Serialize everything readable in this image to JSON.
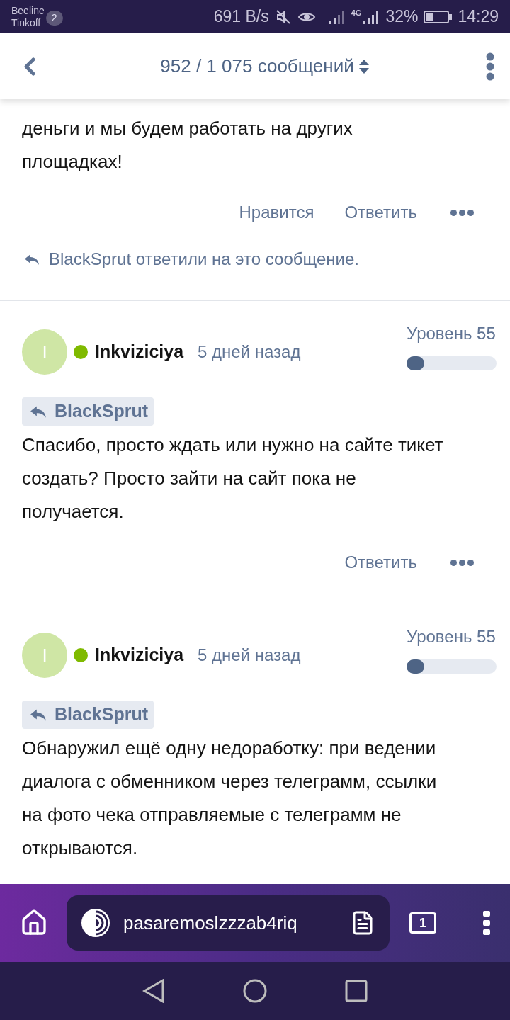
{
  "status_bar": {
    "carriers": [
      "Beeline",
      "Tinkoff"
    ],
    "sim_badge": "2",
    "speed": "691 B/s",
    "network": "4G",
    "battery": "32%",
    "time": "14:29"
  },
  "header": {
    "title": "952 / 1 075 сообщений"
  },
  "posts": [
    {
      "text": "деньги и мы будем работать на других площадках!",
      "actions": [
        "Нравится",
        "Ответить"
      ],
      "reply_note": "BlackSprut ответили на это сообщение."
    },
    {
      "author": "Inkviziciya",
      "initial": "I",
      "online": true,
      "time": "5 дней назад",
      "level_label": "Уровень 55",
      "level": 0.2,
      "quote": "BlackSprut",
      "text": "Спасибо, просто ждать или нужно на сайте тикет создать? Просто зайти на сайт пока не получается.",
      "actions": [
        "Ответить"
      ]
    },
    {
      "author": "Inkviziciya",
      "initial": "I",
      "online": true,
      "time": "5 дней назад",
      "level_label": "Уровень 55",
      "level": 0.2,
      "quote": "BlackSprut",
      "text": "Обнаружил ещё одну недоработку: при ведении диалога с обменником через телеграмм, ссылки на фото чека отправляемые с телеграмм не открываются."
    }
  ],
  "browser": {
    "url": "pasaremoslzzzab4riq",
    "tab_count": "1"
  }
}
